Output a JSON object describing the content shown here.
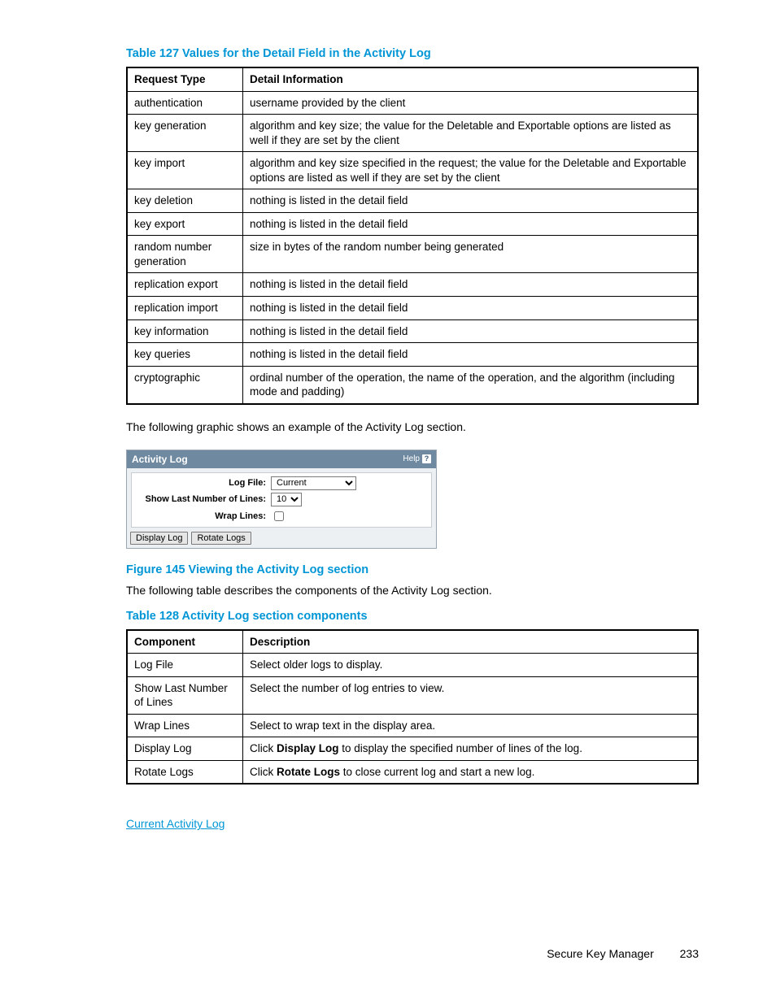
{
  "table127": {
    "caption": "Table 127 Values for the Detail Field in the Activity Log",
    "headers": [
      "Request Type",
      "Detail Information"
    ],
    "rows": [
      [
        "authentication",
        "username provided by the client"
      ],
      [
        "key generation",
        "algorithm and key size; the value for the Deletable and Exportable options are listed as well if they are set by the client"
      ],
      [
        "key import",
        "algorithm and key size specified in the request; the value for the Deletable and Exportable options are listed as well if they are set by the client"
      ],
      [
        "key deletion",
        "nothing is listed in the detail field"
      ],
      [
        "key export",
        "nothing is listed in the detail field"
      ],
      [
        "random number generation",
        "size in bytes of the random number being generated"
      ],
      [
        "replication export",
        "nothing is listed in the detail field"
      ],
      [
        "replication import",
        "nothing is listed in the detail field"
      ],
      [
        "key information",
        "nothing is listed in the detail field"
      ],
      [
        "key queries",
        "nothing is listed in the detail field"
      ],
      [
        "cryptographic",
        "ordinal number of the operation, the name of the operation, and the algorithm (including mode and padding)"
      ]
    ]
  },
  "para_after_t127": "The following graphic shows an example of the Activity Log section.",
  "widget": {
    "title": "Activity Log",
    "help": "Help",
    "help_icon": "?",
    "labels": {
      "log_file": "Log File:",
      "show_last": "Show Last Number of Lines:",
      "wrap": "Wrap Lines:"
    },
    "values": {
      "log_file": "Current",
      "lines": "10"
    },
    "btn_display": "Display Log",
    "btn_rotate": "Rotate Logs"
  },
  "figure145": "Figure 145 Viewing the Activity Log section",
  "para_after_fig": "The following table describes the components of the Activity Log section.",
  "table128": {
    "caption": "Table 128 Activity Log section components",
    "headers": [
      "Component",
      "Description"
    ],
    "rows": [
      {
        "c0": "Log File",
        "c1_pre": "",
        "c1_b": "",
        "c1_post": "Select older logs to display."
      },
      {
        "c0": "Show Last Number of Lines",
        "c1_pre": "",
        "c1_b": "",
        "c1_post": "Select the number of log entries to view."
      },
      {
        "c0": "Wrap Lines",
        "c1_pre": "",
        "c1_b": "",
        "c1_post": "Select to wrap text in the display area."
      },
      {
        "c0": "Display Log",
        "c1_pre": "Click ",
        "c1_b": "Display Log",
        "c1_post": " to display the specified number of lines of the log."
      },
      {
        "c0": "Rotate Logs",
        "c1_pre": "Click ",
        "c1_b": "Rotate Logs",
        "c1_post": " to close current log and start a new log."
      }
    ]
  },
  "link_text": "Current Activity Log",
  "footer": {
    "title": "Secure Key Manager",
    "page": "233"
  }
}
